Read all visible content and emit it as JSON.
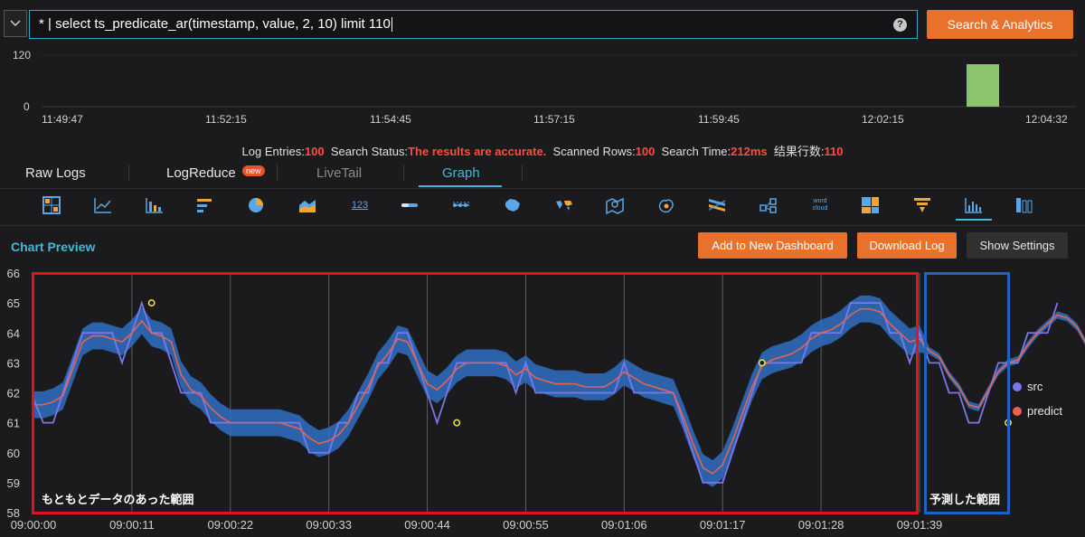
{
  "query": {
    "text": "* | select ts_predicate_ar(timestamp, value, 2, 10) limit 110",
    "help": "?",
    "search_button": "Search & Analytics"
  },
  "histogram": {
    "y_ticks": [
      "120",
      "0"
    ],
    "x_ticks": [
      "11:49:47",
      "11:52:15",
      "11:54:45",
      "11:57:15",
      "11:59:45",
      "12:02:15",
      "12:04:32"
    ],
    "bar_color": "#8cc46e"
  },
  "status": {
    "log_entries_label": "Log Entries:",
    "log_entries": "100",
    "search_status_label": "Search Status:",
    "search_status": "The results are accurate.",
    "scanned_rows_label": "Scanned Rows:",
    "scanned_rows": "100",
    "search_time_label": "Search Time:",
    "search_time": "212ms",
    "result_count_label": "结果行数:",
    "result_count": "110"
  },
  "tabs": {
    "raw_logs": "Raw Logs",
    "log_reduce": "LogReduce",
    "new_badge": "new",
    "live_tail": "LiveTail",
    "graph": "Graph"
  },
  "chart_type_icons": [
    "table-icon",
    "line-chart-icon",
    "column-chart-icon",
    "bar-chart-icon",
    "pie-chart-icon",
    "area-chart-icon",
    "single-value-icon",
    "progress-bar-icon",
    "flow-graph-icon",
    "china-map-icon",
    "world-map-icon",
    "geo-map-icon",
    "heat-map-icon",
    "sankey-icon",
    "topology-icon",
    "word-cloud-icon",
    "treemap-icon",
    "funnel-icon",
    "time-series-icon",
    "cross-table-icon"
  ],
  "chart_type_text": {
    "single_value": "123",
    "word_cloud": "word cloud"
  },
  "preview": {
    "title": "Chart Preview",
    "add_dashboard": "Add to New Dashboard",
    "download_log": "Download Log",
    "show_settings": "Show Settings"
  },
  "annotations": {
    "original_region": "もともとデータのあった範囲",
    "predicted_region": "予測した範囲",
    "original_color": "#e0141e",
    "predicted_color": "#1d63c4"
  },
  "chart_data": {
    "type": "line",
    "x_ticks": [
      "09:00:00",
      "09:00:11",
      "09:00:22",
      "09:00:33",
      "09:00:44",
      "09:00:55",
      "09:01:06",
      "09:01:17",
      "09:01:28",
      "09:01:39"
    ],
    "y_ticks": [
      58,
      59,
      60,
      61,
      62,
      63,
      64,
      65,
      66
    ],
    "ylim": [
      58,
      66
    ],
    "xlim": [
      0,
      109
    ],
    "grid": "vertical",
    "legend_position": "right",
    "series": [
      {
        "name": "src",
        "color": "#7a78ee",
        "values": [
          61.8,
          61.0,
          61.0,
          62.0,
          63.0,
          64.0,
          64.0,
          64.0,
          64.0,
          63.0,
          64.0,
          65.0,
          64.0,
          64.0,
          63.0,
          62.0,
          62.0,
          62.0,
          61.0,
          61.0,
          61.0,
          61.0,
          61.0,
          61.0,
          61.0,
          61.0,
          61.0,
          61.0,
          60.0,
          60.0,
          60.0,
          61.0,
          61.0,
          62.0,
          62.0,
          63.0,
          63.0,
          64.0,
          64.0,
          63.0,
          62.0,
          61.0,
          62.0,
          63.0,
          63.0,
          63.0,
          63.0,
          63.0,
          63.0,
          62.0,
          63.0,
          62.0,
          62.0,
          62.0,
          62.0,
          62.0,
          62.0,
          62.0,
          62.0,
          62.0,
          63.0,
          62.0,
          62.0,
          62.0,
          62.0,
          62.0,
          61.0,
          60.0,
          59.0,
          59.0,
          59.0,
          60.0,
          61.0,
          62.0,
          63.0,
          63.0,
          63.0,
          63.0,
          63.0,
          64.0,
          64.0,
          64.0,
          64.0,
          65.0,
          65.0,
          65.0,
          65.0,
          64.0,
          64.0,
          63.0,
          64.0,
          63.0,
          63.0,
          62.0,
          62.0,
          61.0,
          61.0,
          62.0,
          63.0,
          63.0,
          63.0,
          64.0,
          64.0,
          64.0,
          65.0,
          null,
          null,
          null,
          null,
          null
        ]
      },
      {
        "name": "predict",
        "color": "#e8634f",
        "values": [
          61.6,
          61.6,
          61.7,
          61.9,
          62.8,
          63.7,
          63.9,
          63.9,
          63.8,
          63.7,
          64.0,
          64.4,
          64.0,
          63.9,
          63.7,
          62.6,
          62.1,
          61.9,
          61.5,
          61.2,
          61.0,
          61.0,
          61.0,
          61.0,
          61.0,
          61.0,
          60.9,
          60.8,
          60.5,
          60.3,
          60.4,
          60.6,
          61.0,
          61.6,
          62.2,
          62.9,
          63.3,
          63.8,
          63.7,
          63.0,
          62.3,
          62.1,
          62.4,
          62.8,
          63.0,
          63.0,
          63.0,
          63.0,
          62.9,
          62.6,
          62.8,
          62.5,
          62.4,
          62.3,
          62.3,
          62.3,
          62.2,
          62.2,
          62.2,
          62.4,
          62.7,
          62.5,
          62.3,
          62.2,
          62.1,
          62.0,
          61.2,
          60.3,
          59.5,
          59.3,
          59.6,
          60.4,
          61.3,
          62.2,
          62.9,
          63.1,
          63.2,
          63.3,
          63.5,
          63.8,
          64.0,
          64.1,
          64.3,
          64.6,
          64.8,
          64.8,
          64.7,
          64.3,
          64.0,
          63.7,
          63.8,
          63.4,
          63.2,
          62.6,
          62.2,
          61.6,
          61.5,
          62.1,
          62.7,
          63.0,
          63.1,
          63.6,
          64.0,
          64.3,
          64.6,
          64.5,
          64.2,
          63.6,
          62.9,
          62.3
        ]
      }
    ],
    "highlighted_points": [
      [
        12,
        65
      ],
      [
        43,
        61
      ],
      [
        74,
        63
      ],
      [
        99,
        61
      ]
    ]
  }
}
